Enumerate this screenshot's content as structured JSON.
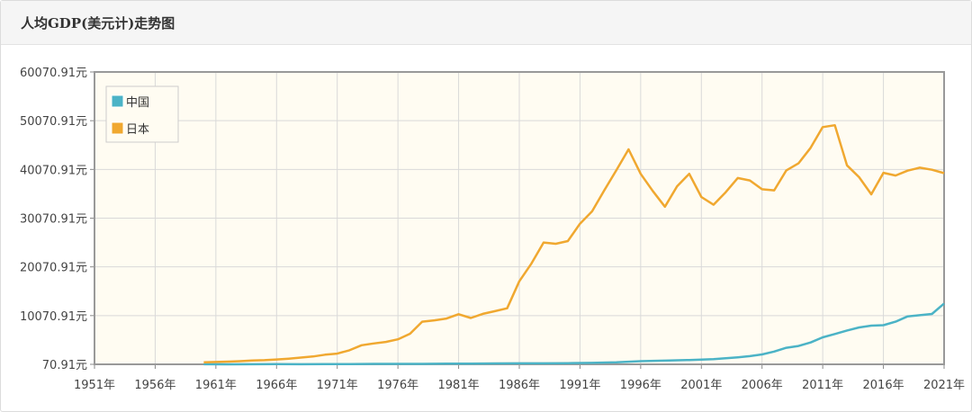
{
  "panel": {
    "title": "人均GDP(美元计)走势图"
  },
  "chart_data": {
    "type": "line",
    "ylim": [
      70.91,
      60070.91
    ],
    "yticks": [
      "70.91元",
      "10070.91元",
      "20070.91元",
      "30070.91元",
      "40070.91元",
      "50070.91元",
      "60070.91元"
    ],
    "ytick_values": [
      70.91,
      10070.91,
      20070.91,
      30070.91,
      40070.91,
      50070.91,
      60070.91
    ],
    "xlim": [
      1951,
      2021
    ],
    "xticks": [
      "1951年",
      "1956年",
      "1961年",
      "1966年",
      "1971年",
      "1976年",
      "1981年",
      "1986年",
      "1991年",
      "1996年",
      "2001年",
      "2006年",
      "2011年",
      "2016年",
      "2021年"
    ],
    "xtick_values": [
      1951,
      1956,
      1961,
      1966,
      1971,
      1976,
      1981,
      1986,
      1991,
      1996,
      2001,
      2006,
      2011,
      2016,
      2021
    ],
    "grid": true,
    "legend_position": "top-left",
    "series": [
      {
        "name": "中国",
        "color": "#4bb3c6",
        "x": [
          1960,
          1962,
          1964,
          1966,
          1968,
          1970,
          1972,
          1974,
          1976,
          1978,
          1980,
          1982,
          1984,
          1986,
          1988,
          1990,
          1992,
          1994,
          1996,
          1998,
          2000,
          2002,
          2004,
          2005,
          2006,
          2007,
          2008,
          2009,
          2010,
          2011,
          2012,
          2013,
          2014,
          2015,
          2016,
          2017,
          2018,
          2019,
          2020,
          2021
        ],
        "y": [
          89,
          71,
          85,
          102,
          90,
          113,
          132,
          157,
          165,
          156,
          195,
          203,
          251,
          282,
          283,
          318,
          366,
          473,
          709,
          829,
          959,
          1148,
          1509,
          1753,
          2099,
          2694,
          3468,
          3832,
          4550,
          5614,
          6300,
          7020,
          7636,
          8016,
          8094,
          8817,
          9905,
          10144,
          10409,
          12556
        ]
      },
      {
        "name": "日本",
        "color": "#f0a830",
        "x": [
          1960,
          1961,
          1962,
          1963,
          1964,
          1965,
          1966,
          1967,
          1968,
          1969,
          1970,
          1971,
          1972,
          1973,
          1974,
          1975,
          1976,
          1977,
          1978,
          1979,
          1980,
          1981,
          1982,
          1983,
          1984,
          1985,
          1986,
          1987,
          1988,
          1989,
          1990,
          1991,
          1992,
          1993,
          1994,
          1995,
          1996,
          1997,
          1998,
          1999,
          2000,
          2001,
          2002,
          2003,
          2004,
          2005,
          2006,
          2007,
          2008,
          2009,
          2010,
          2011,
          2012,
          2013,
          2014,
          2015,
          2016,
          2017,
          2018,
          2019,
          2020,
          2021
        ],
        "y": [
          480,
          560,
          630,
          720,
          840,
          920,
          1060,
          1230,
          1450,
          1670,
          2040,
          2270,
          2950,
          3990,
          4350,
          4660,
          5200,
          6340,
          8820,
          9100,
          9460,
          10360,
          9580,
          10420,
          10980,
          11580,
          17110,
          20770,
          25060,
          24810,
          25360,
          28930,
          31470,
          35770,
          39930,
          44200,
          39150,
          35640,
          32420,
          36610,
          39170,
          34410,
          32820,
          35390,
          38300,
          37810,
          35990,
          35780,
          39880,
          41310,
          44510,
          48760,
          49150,
          40900,
          38470,
          34960,
          39370,
          38830,
          39810,
          40420,
          40000,
          39310
        ]
      }
    ]
  }
}
